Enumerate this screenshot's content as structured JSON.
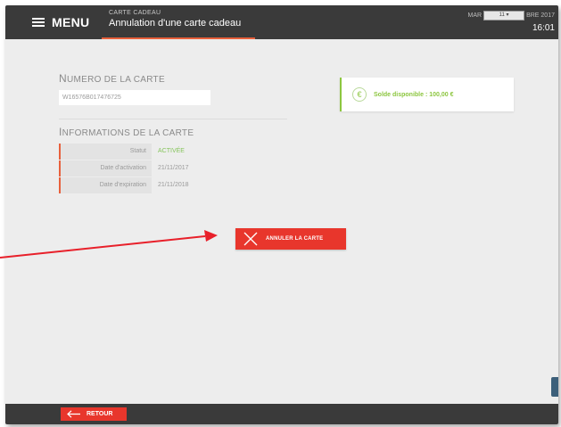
{
  "topbar": {
    "menu_label": "MENU",
    "section_label": "CARTE CADEAU",
    "page_title": "Annulation d'une carte cadeau",
    "date_prefix": "MAR",
    "date_select_value": "11",
    "date_suffix": "BRE 2017",
    "time": "16:01"
  },
  "card": {
    "number_title_initial": "N",
    "number_title_rest": "UMERO DE LA CARTE",
    "number_value": "W16576B017476725",
    "info_title_initial": "I",
    "info_title_rest": "NFORMATIONS DE LA CARTE",
    "rows": [
      {
        "label": "Statut",
        "value": "ACTIVÉE"
      },
      {
        "label": "Date d'activation",
        "value": "21/11/2017"
      },
      {
        "label": "Date d'expiration",
        "value": "21/11/2018"
      }
    ]
  },
  "balance": {
    "icon": "euro-icon",
    "text": "Solde disponible : 100,00 €"
  },
  "actions": {
    "cancel_label": "ANNULER LA CARTE",
    "back_label": "RETOUR"
  },
  "colors": {
    "accent": "#e8362c",
    "orange": "#e8603c",
    "green": "#8cc63f",
    "topbar": "#3a3a3a",
    "background": "#ededed"
  }
}
